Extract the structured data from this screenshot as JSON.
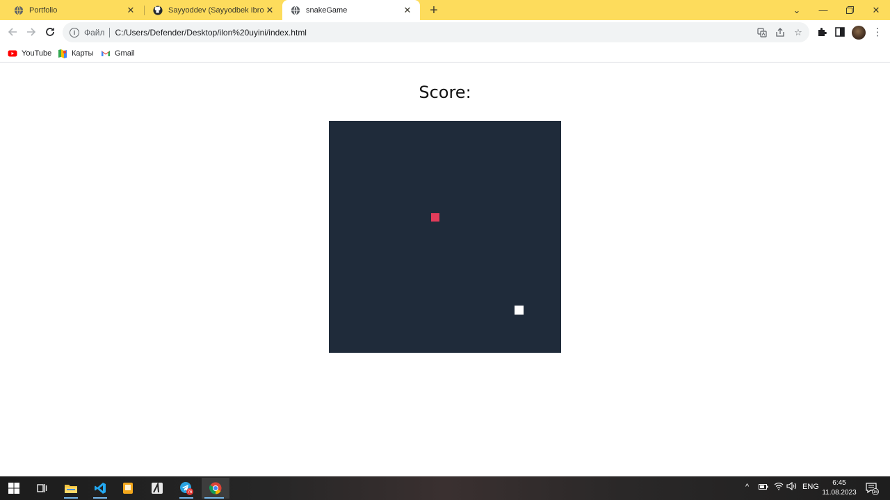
{
  "tabs": [
    {
      "title": "Portfolio",
      "icon": "globe-icon"
    },
    {
      "title": "Sayyoddev (Sayyodbek Ibrohimov)",
      "icon": "github-icon"
    },
    {
      "title": "snakeGame",
      "icon": "globe-icon",
      "active": true
    }
  ],
  "toolbar": {
    "file_label": "Файл",
    "url": "C:/Users/Defender/Desktop/ilon%20uyini/index.html"
  },
  "bookmarks": [
    {
      "label": "YouTube",
      "icon": "youtube-icon"
    },
    {
      "label": "Карты",
      "icon": "maps-icon"
    },
    {
      "label": "Gmail",
      "icon": "gmail-icon"
    }
  ],
  "game": {
    "score_label": "Score:",
    "colors": {
      "board": "#1f2b3a",
      "food": "#e23c5a",
      "snake": "#ffffff"
    }
  },
  "taskbar": {
    "language": "ENG",
    "time": "6:45",
    "date": "11.08.2023",
    "telegram_badge": "76",
    "notifications": "16"
  }
}
